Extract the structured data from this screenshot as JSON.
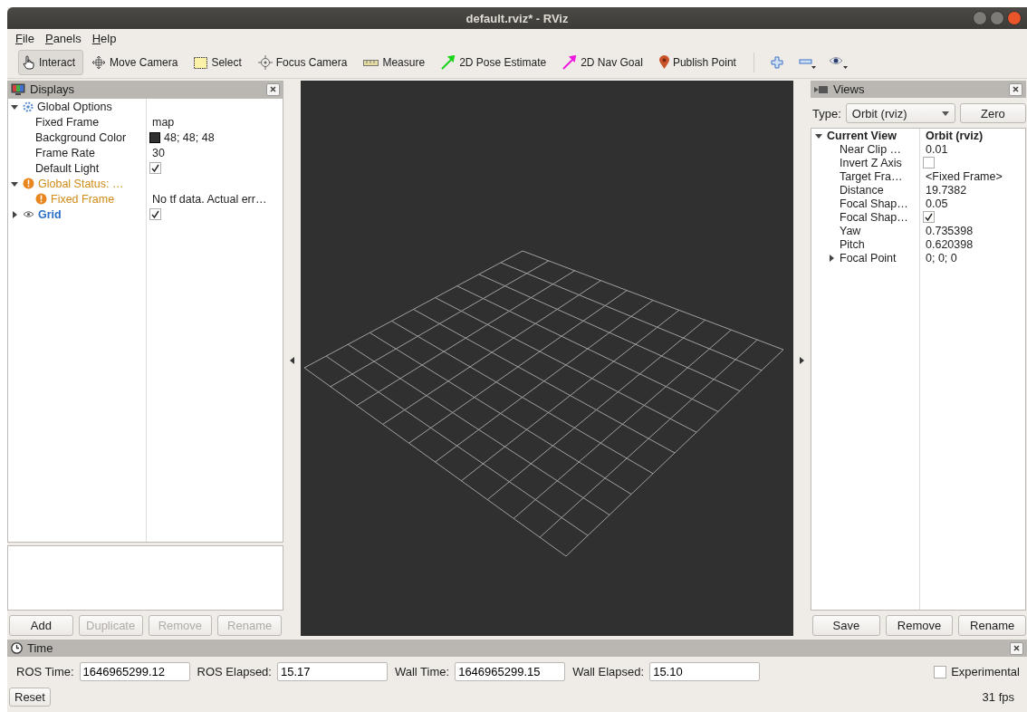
{
  "window": {
    "title": "default.rviz* - RViz"
  },
  "menu": [
    {
      "label": "File"
    },
    {
      "label": "Panels"
    },
    {
      "label": "Help"
    }
  ],
  "toolbar": {
    "tools": [
      {
        "kind": "interact",
        "label": "Interact",
        "selected": true
      },
      {
        "kind": "move",
        "label": "Move Camera",
        "selected": false
      },
      {
        "kind": "select",
        "label": "Select",
        "selected": false
      },
      {
        "kind": "focus",
        "label": "Focus Camera",
        "selected": false
      },
      {
        "kind": "measure",
        "label": "Measure",
        "selected": false
      },
      {
        "kind": "pose",
        "label": "2D Pose Estimate",
        "selected": false
      },
      {
        "kind": "nav",
        "label": "2D Nav Goal",
        "selected": false
      },
      {
        "kind": "point",
        "label": "Publish Point",
        "selected": false
      }
    ],
    "actions": [
      {
        "kind": "plus"
      },
      {
        "kind": "minus"
      },
      {
        "kind": "eye"
      }
    ]
  },
  "displays": {
    "title": "Displays",
    "tree": [
      {
        "kind": "group",
        "label": "Global Options",
        "expanded": true,
        "children": [
          {
            "kind": "text",
            "label": "Fixed Frame",
            "value": "map"
          },
          {
            "kind": "color",
            "label": "Background Color",
            "value": "48; 48; 48"
          },
          {
            "kind": "text",
            "label": "Frame Rate",
            "value": "30"
          },
          {
            "kind": "check",
            "label": "Default Light",
            "checked": true
          }
        ]
      },
      {
        "kind": "warning",
        "label": "Global Status: …",
        "expanded": true,
        "children": [
          {
            "kind": "warning",
            "label": "Fixed Frame",
            "value": "No tf data.  Actual err…"
          }
        ]
      },
      {
        "kind": "display",
        "label": "Grid",
        "expanded": false,
        "checked": true
      }
    ],
    "buttons": [
      {
        "label": "Add",
        "disabled": false
      },
      {
        "label": "Duplicate",
        "disabled": true
      },
      {
        "label": "Remove",
        "disabled": true
      },
      {
        "label": "Rename",
        "disabled": true
      }
    ]
  },
  "views": {
    "title": "Views",
    "type_label": "Type:",
    "type_value": "Orbit (rviz)",
    "zero": "Zero",
    "tree": [
      {
        "kind": "header",
        "label": "Current View",
        "value": "Orbit (rviz)",
        "expanded": true,
        "children": [
          {
            "kind": "text",
            "label": "Near Clip …",
            "value": "0.01"
          },
          {
            "kind": "check",
            "label": "Invert Z Axis",
            "checked": false
          },
          {
            "kind": "text",
            "label": "Target Fra…",
            "value": "<Fixed Frame>"
          },
          {
            "kind": "text",
            "label": "Distance",
            "value": "19.7382"
          },
          {
            "kind": "text",
            "label": "Focal Shap…",
            "value": "0.05"
          },
          {
            "kind": "check",
            "label": "Focal Shap…",
            "checked": true
          },
          {
            "kind": "text",
            "label": "Yaw",
            "value": "0.735398"
          },
          {
            "kind": "text",
            "label": "Pitch",
            "value": "0.620398"
          },
          {
            "kind": "text",
            "label": "Focal Point",
            "value": "0; 0; 0",
            "expanded": false
          }
        ]
      }
    ],
    "buttons": [
      {
        "label": "Save"
      },
      {
        "label": "Remove"
      },
      {
        "label": "Rename"
      }
    ]
  },
  "time": {
    "title": "Time",
    "fields": [
      {
        "label": "ROS Time:",
        "value": "1646965299.12"
      },
      {
        "label": "ROS Elapsed:",
        "value": "15.17"
      },
      {
        "label": "Wall Time:",
        "value": "1646965299.15"
      },
      {
        "label": "Wall Elapsed:",
        "value": "15.10"
      }
    ],
    "experimental": {
      "label": "Experimental",
      "checked": false
    },
    "reset": "Reset",
    "fps": "31 fps"
  }
}
